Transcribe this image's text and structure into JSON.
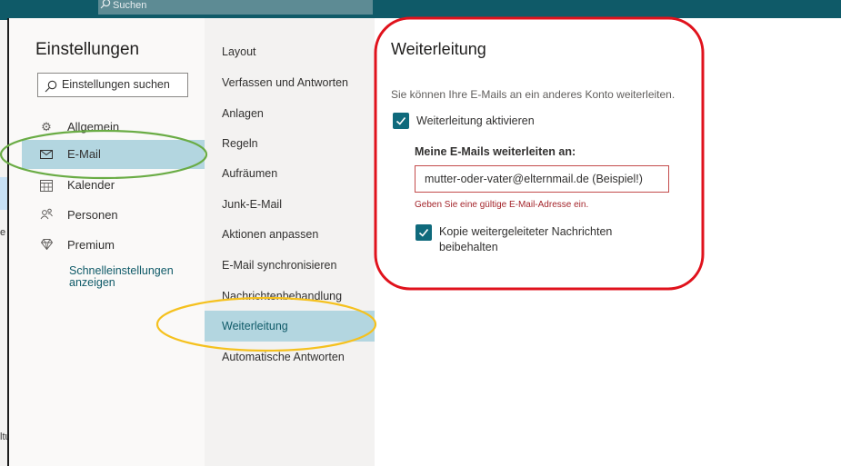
{
  "background": {
    "search_placeholder": "Suchen",
    "left_fragments": [
      "e",
      "ltu"
    ]
  },
  "settings": {
    "title": "Einstellungen",
    "search_placeholder": "Einstellungen suchen",
    "nav": [
      {
        "label": "Allgemein",
        "icon": "gear-icon"
      },
      {
        "label": "E-Mail",
        "icon": "mail-icon",
        "active": true
      },
      {
        "label": "Kalender",
        "icon": "calendar-icon"
      },
      {
        "label": "Personen",
        "icon": "people-icon"
      },
      {
        "label": "Premium",
        "icon": "diamond-icon"
      }
    ],
    "quick_settings_link": "Schnelleinstellungen anzeigen"
  },
  "mail_sections": [
    "Layout",
    "Verfassen und Antworten",
    "Anlagen",
    "Regeln",
    "Aufräumen",
    "Junk-E-Mail",
    "Aktionen anpassen",
    "E-Mail synchronisieren",
    "Nachrichtenbehandlung",
    "Weiterleitung",
    "Automatische Antworten"
  ],
  "active_section": "Weiterleitung",
  "forwarding": {
    "title": "Weiterleitung",
    "description": "Sie können Ihre E-Mails an ein anderes Konto weiterleiten.",
    "enable_label": "Weiterleitung aktivieren",
    "enable_checked": true,
    "forward_to_label": "Meine E-Mails weiterleiten an:",
    "email_value": "mutter-oder-vater@elternmail.de (Beispiel!)",
    "error": "Geben Sie eine gültige E-Mail-Adresse ein.",
    "keep_copy_label": "Kopie weitergeleiteter Nachrichten beibehalten",
    "keep_copy_checked": true
  },
  "annotations": {
    "colors": {
      "green": "#6aac45",
      "yellow": "#f5c11e",
      "red": "#e0121c"
    },
    "accent": "#0f6a7c",
    "selected_bg": "#b3d6e0"
  }
}
